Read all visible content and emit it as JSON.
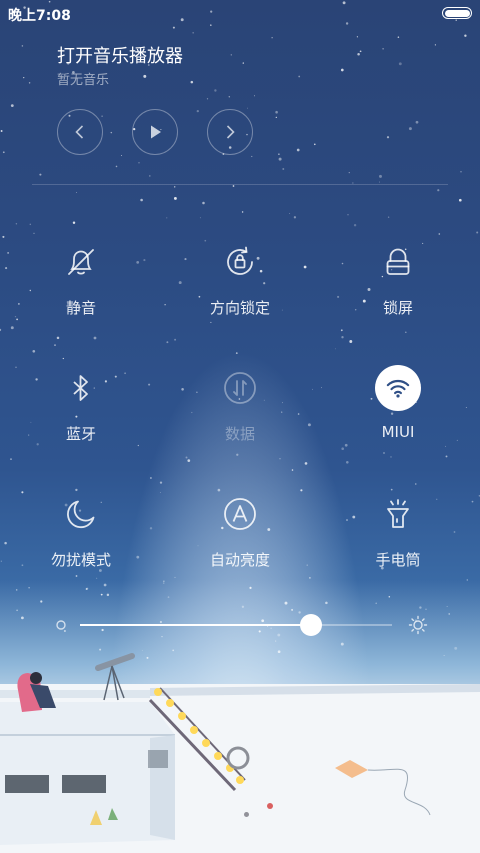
{
  "status_bar": {
    "time": "晚上7:08",
    "battery_level": 1.0
  },
  "music": {
    "title": "打开音乐播放器",
    "subtitle": "暂无音乐",
    "controls": [
      {
        "name": "previous",
        "icon": "chevron-left-icon"
      },
      {
        "name": "play",
        "icon": "play-icon"
      },
      {
        "name": "next",
        "icon": "chevron-right-icon"
      }
    ]
  },
  "toggles": [
    {
      "id": "mute",
      "label": "静音",
      "icon": "bell-slash-icon",
      "state": "off"
    },
    {
      "id": "rotation-lock",
      "label": "方向锁定",
      "icon": "rotation-lock-icon",
      "state": "off"
    },
    {
      "id": "lock-screen",
      "label": "锁屏",
      "icon": "padlock-icon",
      "state": "off"
    },
    {
      "id": "bluetooth",
      "label": "蓝牙",
      "icon": "bluetooth-icon",
      "state": "off"
    },
    {
      "id": "data",
      "label": "数据",
      "icon": "data-arrows-icon",
      "state": "disabled"
    },
    {
      "id": "wifi",
      "label": "MIUI",
      "icon": "wifi-icon",
      "state": "on"
    },
    {
      "id": "dnd",
      "label": "勿扰模式",
      "icon": "moon-icon",
      "state": "off"
    },
    {
      "id": "auto-brightness",
      "label": "自动亮度",
      "icon": "auto-brightness-icon",
      "state": "off"
    },
    {
      "id": "flashlight",
      "label": "手电筒",
      "icon": "flashlight-icon",
      "state": "off"
    }
  ],
  "brightness": {
    "level": 0.74,
    "low_icon": "brightness-low-icon",
    "high_icon": "brightness-high-icon"
  },
  "colors": {
    "background_top": "#2a4476",
    "accent": "#ffffff",
    "active_icon": "#2f4f86"
  }
}
